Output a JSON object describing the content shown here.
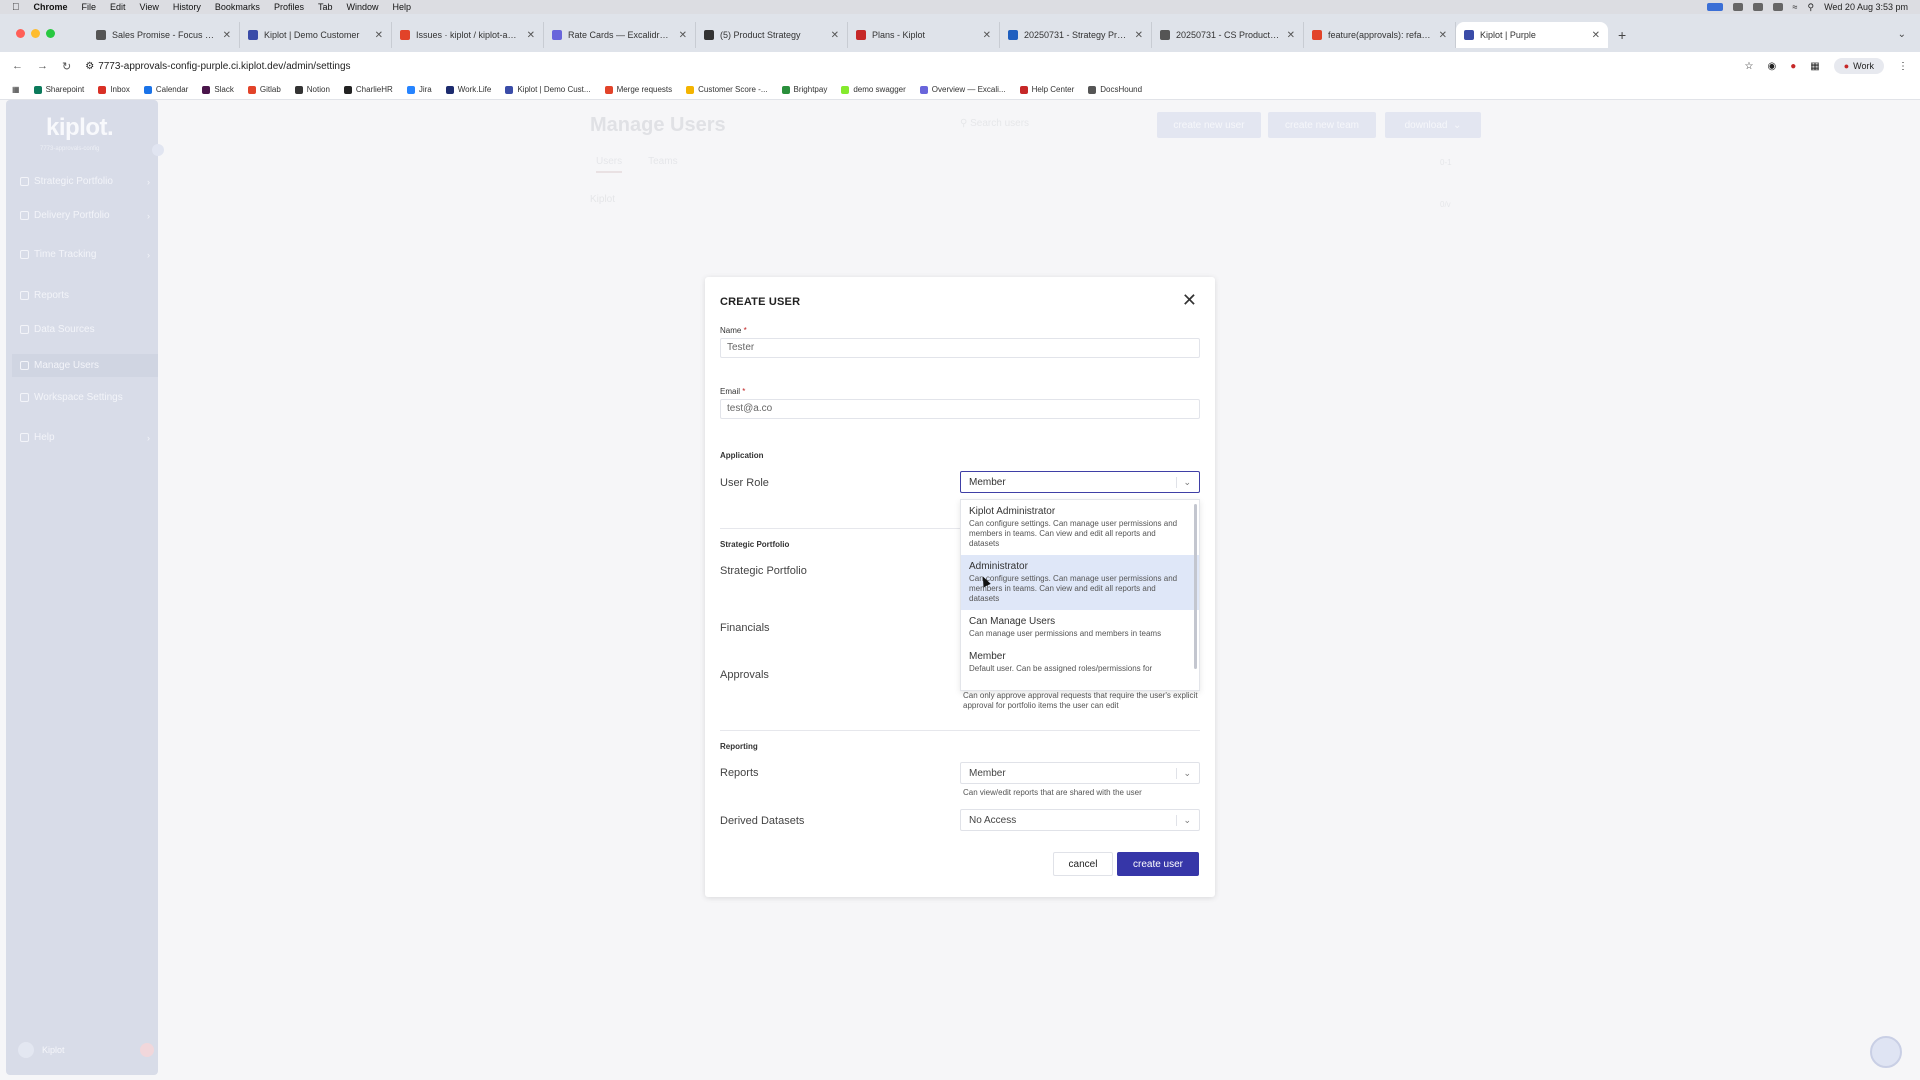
{
  "menubar": {
    "app": "Chrome",
    "items": [
      "File",
      "Edit",
      "View",
      "History",
      "Bookmarks",
      "Profiles",
      "Tab",
      "Window",
      "Help"
    ],
    "clock": "Wed 20 Aug 3:53 pm"
  },
  "tabs": [
    {
      "title": "Sales Promise - Focus — Exc",
      "color": "#555"
    },
    {
      "title": "Kiplot | Demo Customer",
      "color": "#3a4ca8"
    },
    {
      "title": "Issues · kiplot / kiplot-app · G",
      "color": "#e24329"
    },
    {
      "title": "Rate Cards — Excalidraw Plus",
      "color": "#6965db"
    },
    {
      "title": "(5) Product Strategy",
      "color": "#333"
    },
    {
      "title": "Plans - Kiplot",
      "color": "#c62828"
    },
    {
      "title": "20250731 - Strategy Product",
      "color": "#1f5fbf"
    },
    {
      "title": "20250731 - CS Product Prior",
      "color": "#555"
    },
    {
      "title": "feature(approvals): refactor t",
      "color": "#e24329"
    },
    {
      "title": "Kiplot | Purple",
      "color": "#3a4ca8",
      "active": true
    }
  ],
  "address": {
    "url": "7773-approvals-config-purple.ci.kiplot.dev/admin/settings",
    "profile": "Work"
  },
  "bookmarks": [
    {
      "label": "Sharepoint",
      "color": "#0b7a5b"
    },
    {
      "label": "Inbox",
      "color": "#d93025"
    },
    {
      "label": "Calendar",
      "color": "#1a73e8"
    },
    {
      "label": "Slack",
      "color": "#4a154b"
    },
    {
      "label": "Gitlab",
      "color": "#e24329"
    },
    {
      "label": "Notion",
      "color": "#333"
    },
    {
      "label": "CharlieHR",
      "color": "#222"
    },
    {
      "label": "Jira",
      "color": "#2684ff"
    },
    {
      "label": "Work.Life",
      "color": "#1c2b6e"
    },
    {
      "label": "Kiplot | Demo Cust...",
      "color": "#3a4ca8"
    },
    {
      "label": "Merge requests",
      "color": "#e24329"
    },
    {
      "label": "Customer Score -...",
      "color": "#f4b400"
    },
    {
      "label": "Brightpay",
      "color": "#2a8f3c"
    },
    {
      "label": "demo swagger",
      "color": "#85ea2d"
    },
    {
      "label": "Overview — Excali...",
      "color": "#6965db"
    },
    {
      "label": "Help Center",
      "color": "#c62828"
    },
    {
      "label": "DocsHound",
      "color": "#555"
    }
  ],
  "sidebar": {
    "logo": "kiplot.",
    "subtitle": "7773-approvals-config",
    "items": [
      {
        "label": "Strategic Portfolio",
        "chevron": true
      },
      {
        "label": "Delivery Portfolio",
        "chevron": true
      },
      {
        "label": "Time Tracking",
        "chevron": true
      },
      {
        "label": "Reports",
        "chevron": false
      },
      {
        "label": "Data Sources",
        "chevron": false
      },
      {
        "label": "Manage Users",
        "chevron": false,
        "active": true
      },
      {
        "label": "Workspace Settings",
        "chevron": false
      },
      {
        "label": "Help",
        "chevron": true
      }
    ],
    "user": "Kiplot"
  },
  "main": {
    "title": "Manage Users",
    "search_placeholder": "Search users",
    "btn_create_user": "create new user",
    "btn_create_team": "create new team",
    "btn_download": "download",
    "tab_users": "Users",
    "tab_teams": "Teams",
    "row_name": "Kiplot",
    "pagination": "0-1",
    "row_action": "0/v"
  },
  "modal": {
    "title": "CREATE USER",
    "name_label": "Name",
    "name_value": "Tester",
    "email_label": "Email",
    "email_value": "test@a.co",
    "required_mark": "*",
    "section_application": "Application",
    "user_role_label": "User Role",
    "user_role_value": "Member",
    "section_strategic": "Strategic Portfolio",
    "strategic_label": "Strategic Portfolio",
    "financials_label": "Financials",
    "approvals_label": "Approvals",
    "approvals_desc": "Can only approve approval requests that require the user's explicit approval for portfolio items the user can edit",
    "section_reporting": "Reporting",
    "reports_label": "Reports",
    "reports_value": "Member",
    "reports_desc": "Can view/edit reports that are shared with the user",
    "derived_label": "Derived Datasets",
    "derived_value": "No Access",
    "cancel": "cancel",
    "create": "create user"
  },
  "role_options": [
    {
      "title": "Kiplot Administrator",
      "desc": "Can configure settings. Can manage user permissions and members in teams. Can view and edit all reports and datasets"
    },
    {
      "title": "Administrator",
      "desc": "Can configure settings. Can manage user permissions and members in teams. Can view and edit all reports and datasets",
      "highlighted": true
    },
    {
      "title": "Can Manage Users",
      "desc": "Can manage user permissions and members in teams"
    },
    {
      "title": "Member",
      "desc": "Default user. Can be assigned roles/permissions for"
    }
  ],
  "colors": {
    "primary": "#3636a8",
    "sidebar": "#b8bfd5",
    "highlight": "#dfe7f8",
    "required": "#c02424"
  }
}
